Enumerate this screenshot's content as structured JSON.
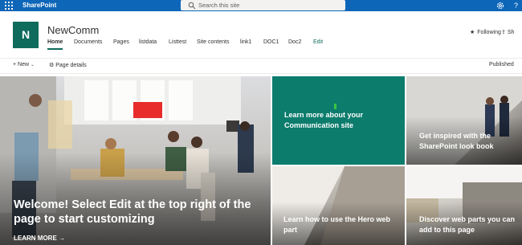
{
  "suite": {
    "brand": "SharePoint",
    "search_placeholder": "Search this site"
  },
  "site": {
    "logo_letter": "N",
    "title": "NewComm",
    "nav": [
      "Home",
      "Documents",
      "Pages",
      "listdata",
      "Listtest",
      "Site contents",
      "link1",
      "DOC1",
      "Doc2",
      "Edit"
    ],
    "following": "Following",
    "share": "Sh"
  },
  "commandbar": {
    "new": "New",
    "page_details": "Page details",
    "status": "Published"
  },
  "hero": {
    "main": {
      "title": "Welcome! Select Edit at the top right of the page to start customizing",
      "link": "LEARN MORE"
    },
    "tiles": [
      "Learn more about your Communication site",
      "Get inspired with the SharePoint look book",
      "Learn how to use the Hero web part",
      "Discover web parts you can add to this page"
    ]
  },
  "colors": {
    "suite_bar": "#0d66b8",
    "theme": "#0f6b5c",
    "teal_tile": "#0c7c6d"
  },
  "icons": [
    "waffle-icon",
    "search-icon",
    "settings-gear-icon",
    "help-icon",
    "star-icon",
    "share-icon",
    "plus-icon",
    "chevron-down-icon",
    "page-details-icon",
    "arrow-right-icon"
  ]
}
